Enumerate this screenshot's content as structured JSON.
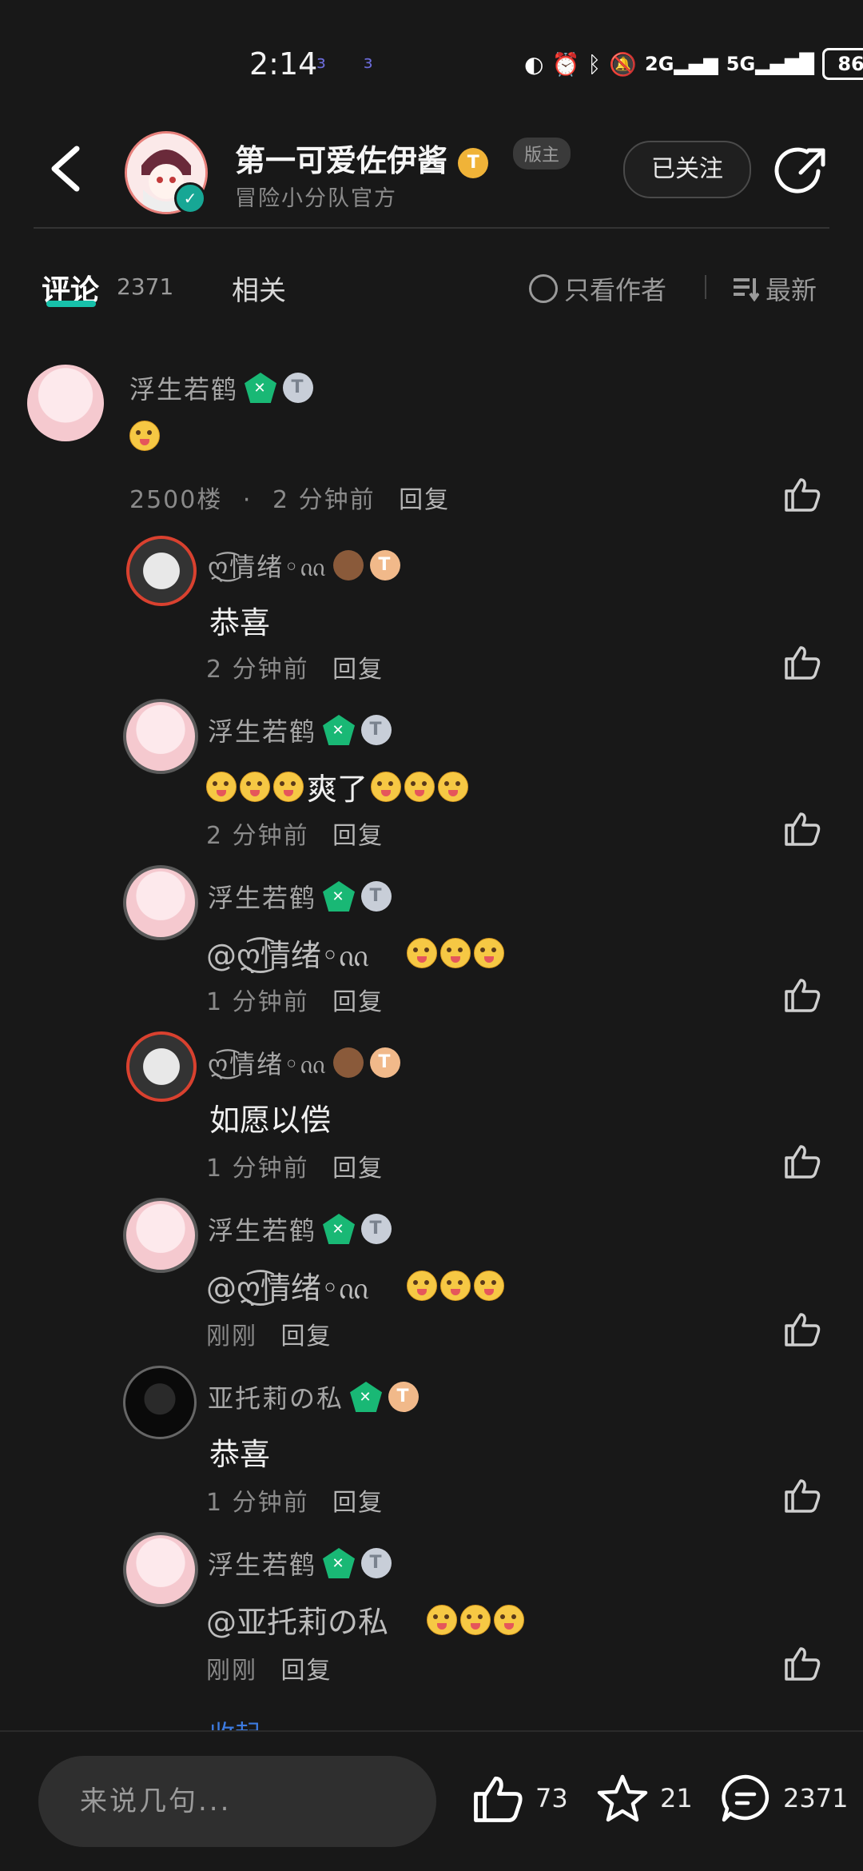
{
  "status": {
    "time": "2:14",
    "network_2g": "2G",
    "network_5g": "5G",
    "battery": "86"
  },
  "header": {
    "title": "第一可爱佐伊酱",
    "subtitle": "冒险小分队官方",
    "level_badge": "T",
    "role_badge": "版主",
    "follow_label": "已关注"
  },
  "tabs": {
    "comments_label": "评论",
    "comments_count": "2371",
    "related_label": "相关",
    "only_author_label": "只看作者",
    "sort_label": "最新"
  },
  "main_comment": {
    "author": "浮生若鹤",
    "floor": "2500楼",
    "dot": "·",
    "time": "2 分钟前",
    "reply_label": "回复"
  },
  "replies": [
    {
      "author": "ღ͜͡情绪◦ᦶ",
      "text": "恭喜",
      "time": "2 分钟前",
      "reply_label": "回复"
    },
    {
      "author": "浮生若鹤",
      "text": "爽了",
      "time": "2 分钟前",
      "reply_label": "回复"
    },
    {
      "author": "浮生若鹤",
      "mention": "@ღ͜͡情绪◦ᦶ",
      "time": "1 分钟前",
      "reply_label": "回复"
    },
    {
      "author": "ღ͜͡情绪◦ᦶ",
      "text": "如愿以偿",
      "time": "1 分钟前",
      "reply_label": "回复"
    },
    {
      "author": "浮生若鹤",
      "mention": "@ღ͜͡情绪◦ᦶ",
      "time": "刚刚",
      "reply_label": "回复"
    },
    {
      "author": "亚托莉の私",
      "text": "恭喜",
      "time": "1 分钟前",
      "reply_label": "回复"
    },
    {
      "author": "浮生若鹤",
      "mention": "@亚托莉の私",
      "time": "刚刚",
      "reply_label": "回复"
    }
  ],
  "collapse_label": "收起",
  "bottom": {
    "input_placeholder": "来说几句...",
    "likes": "73",
    "favorites": "21",
    "comments": "2371"
  },
  "colors": {
    "accent": "#17c1aa",
    "background": "#181818",
    "link": "#3d7be0"
  }
}
